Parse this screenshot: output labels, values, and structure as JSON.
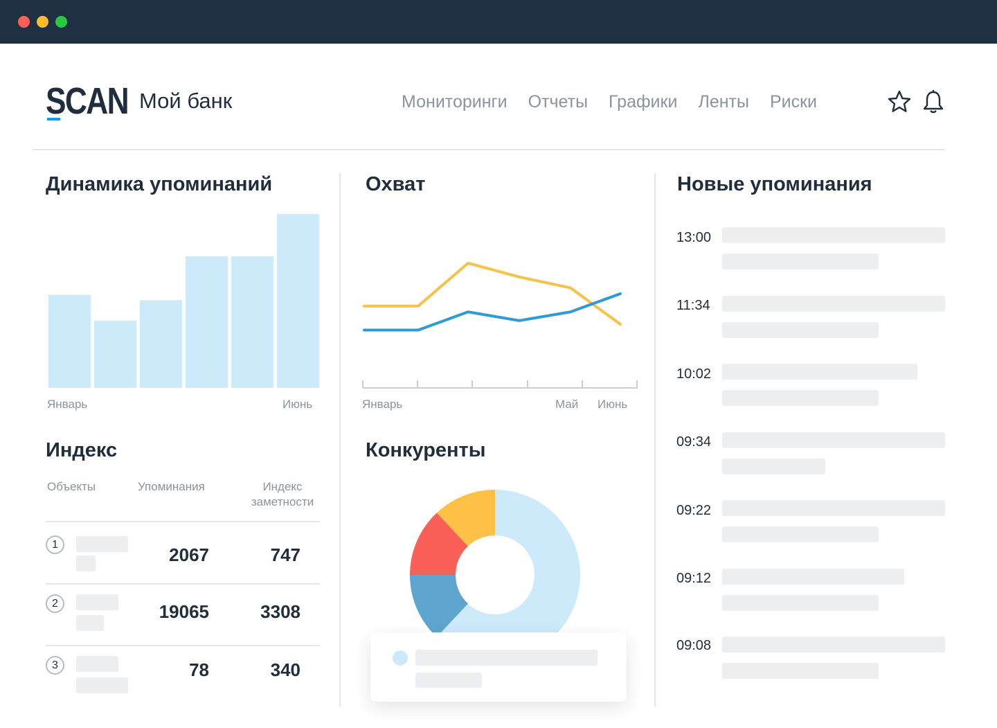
{
  "window": {
    "controls": [
      "close",
      "minimize",
      "maximize"
    ]
  },
  "header": {
    "logo": "SCAN",
    "title": "Мой банк",
    "nav": [
      "Мониторинги",
      "Отчеты",
      "Графики",
      "Ленты",
      "Риски"
    ],
    "icons": [
      "star-icon",
      "bell-icon"
    ],
    "accent": "#0aa0ea"
  },
  "dynamics": {
    "title": "Динамика упоминаний",
    "x_start": "Январь",
    "x_end": "Июнь",
    "chart_data": {
      "type": "bar",
      "values": [
        119,
        86,
        112,
        168,
        168,
        222
      ],
      "color": "#cdeafb"
    }
  },
  "reach": {
    "title": "Охват",
    "x_labels": [
      "Январь",
      "Май",
      "Июнь"
    ],
    "chart_data": {
      "type": "line",
      "series": [
        {
          "color": "#f8c14a",
          "values": [
            103,
            103,
            162,
            143,
            128,
            78
          ]
        },
        {
          "color": "#2e9bd6",
          "values": [
            70,
            70,
            95,
            83,
            95,
            120
          ]
        }
      ]
    }
  },
  "index": {
    "title": "Индекс",
    "columns": [
      "Объекты",
      "Упоминания",
      "Индекс заметности"
    ],
    "rows": [
      {
        "rank": "1",
        "mentions": "2067",
        "index": "747"
      },
      {
        "rank": "2",
        "mentions": "19065",
        "index": "3308"
      },
      {
        "rank": "3",
        "mentions": "78",
        "index": "340"
      }
    ]
  },
  "competitors": {
    "title": "Конкуренты",
    "chart_data": {
      "type": "pie",
      "slices": [
        {
          "value": 62,
          "color": "#cdeafb"
        },
        {
          "value": 13,
          "color": "#5ea6d0"
        },
        {
          "value": 13,
          "color": "#fb6058"
        },
        {
          "value": 12,
          "color": "#fec145"
        }
      ]
    }
  },
  "new_mentions": {
    "title": "Новые упоминания",
    "times": [
      "13:00",
      "11:34",
      "10:02",
      "09:34",
      "09:22",
      "09:12",
      "09:08"
    ]
  }
}
